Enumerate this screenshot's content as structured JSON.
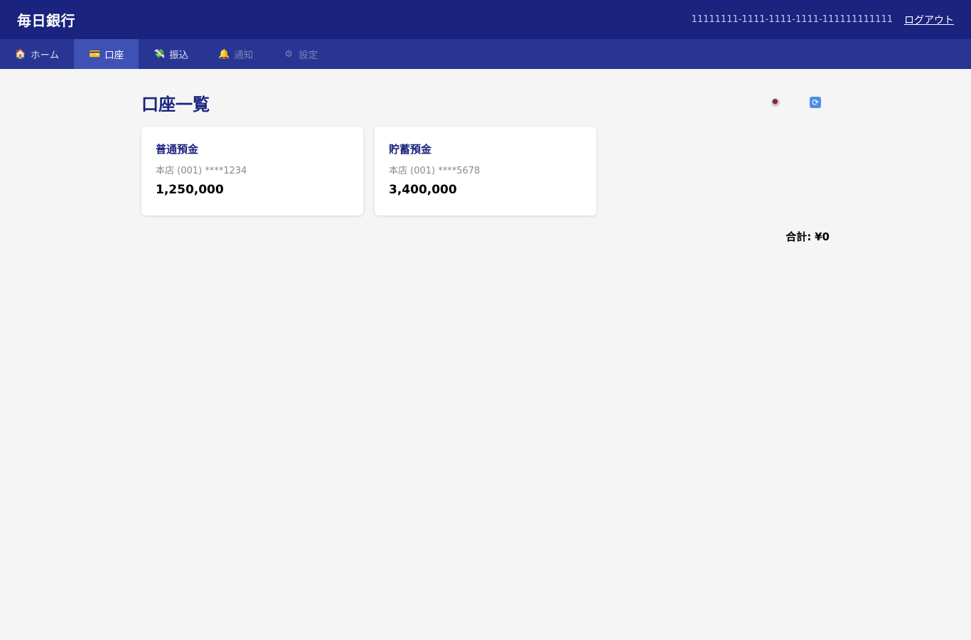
{
  "header": {
    "brand": "毎日銀行",
    "account_id": "11111111-1111-1111-1111-111111111111",
    "logout_label": "ログアウト"
  },
  "nav": {
    "items": [
      {
        "label": "ホーム",
        "icon": "house-icon"
      },
      {
        "label": "口座",
        "icon": "card-icon"
      },
      {
        "label": "振込",
        "icon": "money-icon"
      },
      {
        "label": "通知",
        "icon": "bell-icon"
      },
      {
        "label": "設定",
        "icon": "gear-icon"
      }
    ]
  },
  "main": {
    "title": "口座一覧",
    "tools": {
      "visibility_icon": "eye-icon",
      "refresh_icon": "refresh-icon"
    },
    "accounts": [
      {
        "name": "普通預金",
        "branch": "本店 (001) ****1234",
        "balance": "1,250,000"
      },
      {
        "name": "貯蓄預金",
        "branch": "本店 (001) ****5678",
        "balance": "3,400,000"
      }
    ],
    "total": {
      "label": "合計:",
      "value": "¥0"
    }
  },
  "colors": {
    "header_bg": "#1a237e",
    "nav_bg": "#283593",
    "nav_active_bg": "#3f51b5",
    "title_color": "#1a237e",
    "page_bg": "#f5f5f5"
  }
}
